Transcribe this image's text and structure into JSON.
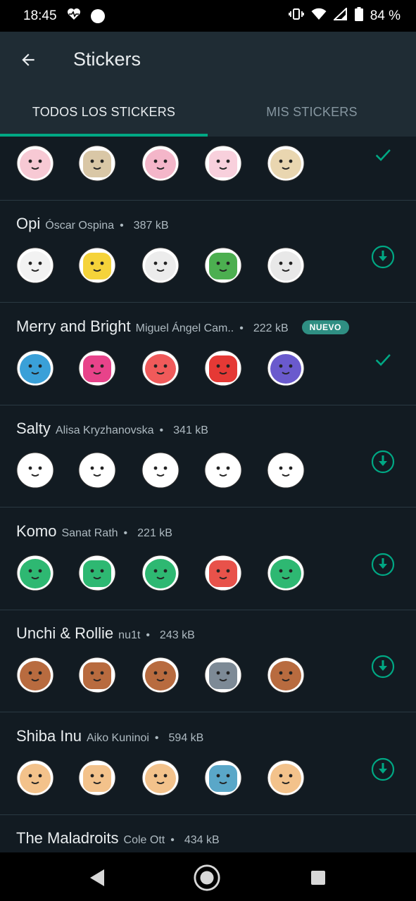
{
  "status_bar": {
    "time": "18:45",
    "battery": "84 %",
    "icons": [
      "heart-monitor-icon",
      "circle-icon",
      "vibrate-icon",
      "wifi-icon",
      "signal-icon",
      "battery-icon"
    ]
  },
  "app_bar": {
    "title": "Stickers",
    "back_icon": "arrow-back-icon"
  },
  "tabs": [
    {
      "label": "TODOS LOS STICKERS",
      "selected": true
    },
    {
      "label": "MIS STICKERS",
      "selected": false
    }
  ],
  "colors": {
    "background": "#121b22",
    "app_bar": "#1f2c34",
    "accent": "#00a884",
    "badge": "#2f8f83",
    "divider": "#2a3942"
  },
  "packs": [
    {
      "name": "",
      "author": "",
      "size": "",
      "badge": "",
      "status": "installed",
      "stickers": [
        "bear-hi",
        "bear-teddy",
        "bear-question",
        "bear-ok",
        "bear-sandwich"
      ],
      "palette": [
        "#f7c9d4",
        "#d9c7a6",
        "#f4b6c9",
        "#f8d0dc",
        "#e9d6b0"
      ]
    },
    {
      "name": "Opi",
      "author": "Óscar Ospina",
      "size": "387 kB",
      "badge": "",
      "status": "download",
      "stickers": [
        "opi-box",
        "opi-yellow",
        "opi-bike",
        "opi-book",
        "opi-bell"
      ],
      "palette": [
        "#f2f2f2",
        "#f5d33a",
        "#ececec",
        "#4caf50",
        "#e8e8e8"
      ]
    },
    {
      "name": "Merry and Bright",
      "author": "Miguel Ángel Cam..",
      "size": "222 kB",
      "badge": "NUEVO",
      "status": "installed",
      "stickers": [
        "hug",
        "crowd",
        "juggler",
        "santa",
        "woman-drink"
      ],
      "palette": [
        "#3aa0d8",
        "#e8438a",
        "#f05a5a",
        "#e53935",
        "#6a5acd"
      ]
    },
    {
      "name": "Salty",
      "author": "Alisa Kryzhanovska",
      "size": "341 kB",
      "badge": "",
      "status": "download",
      "stickers": [
        "face-1",
        "face-2",
        "face-3",
        "face-4",
        "face-5"
      ],
      "palette": [
        "#ffffff",
        "#ffffff",
        "#ffffff",
        "#ffffff",
        "#ffffff"
      ]
    },
    {
      "name": "Komo",
      "author": "Sanat Rath",
      "size": "221 kB",
      "badge": "",
      "status": "download",
      "stickers": [
        "dino-heart",
        "dino-party",
        "dino-sleep",
        "dino-fire",
        "dino-cake"
      ],
      "palette": [
        "#2eb872",
        "#2eb872",
        "#2eb872",
        "#e8524a",
        "#2eb872"
      ]
    },
    {
      "name": "Unchi & Rollie",
      "author": "nu1t",
      "size": "243 kB",
      "badge": "",
      "status": "download",
      "stickers": [
        "capy-love",
        "capy-no",
        "capy-hug",
        "capy-sleep",
        "capy-angry"
      ],
      "palette": [
        "#b86b3f",
        "#b86b3f",
        "#b86b3f",
        "#7d8a96",
        "#b86b3f"
      ]
    },
    {
      "name": "Shiba Inu",
      "author": "Aiko Kuninoi",
      "size": "594 kB",
      "badge": "",
      "status": "download",
      "stickers": [
        "shiba-bark",
        "shiba-eat",
        "shiba-scared",
        "shiba-house",
        "shiba-play"
      ],
      "palette": [
        "#f3c28b",
        "#f3c28b",
        "#f3c28b",
        "#5aa7c8",
        "#f3c28b"
      ]
    },
    {
      "name": "The Maladroits",
      "author": "Cole Ott",
      "size": "434 kB",
      "badge": "",
      "status": "download",
      "stickers": [],
      "palette": []
    }
  ],
  "nav_bar": {
    "back": "triangle-back-icon",
    "home": "circle-home-icon",
    "recents": "square-recents-icon"
  }
}
